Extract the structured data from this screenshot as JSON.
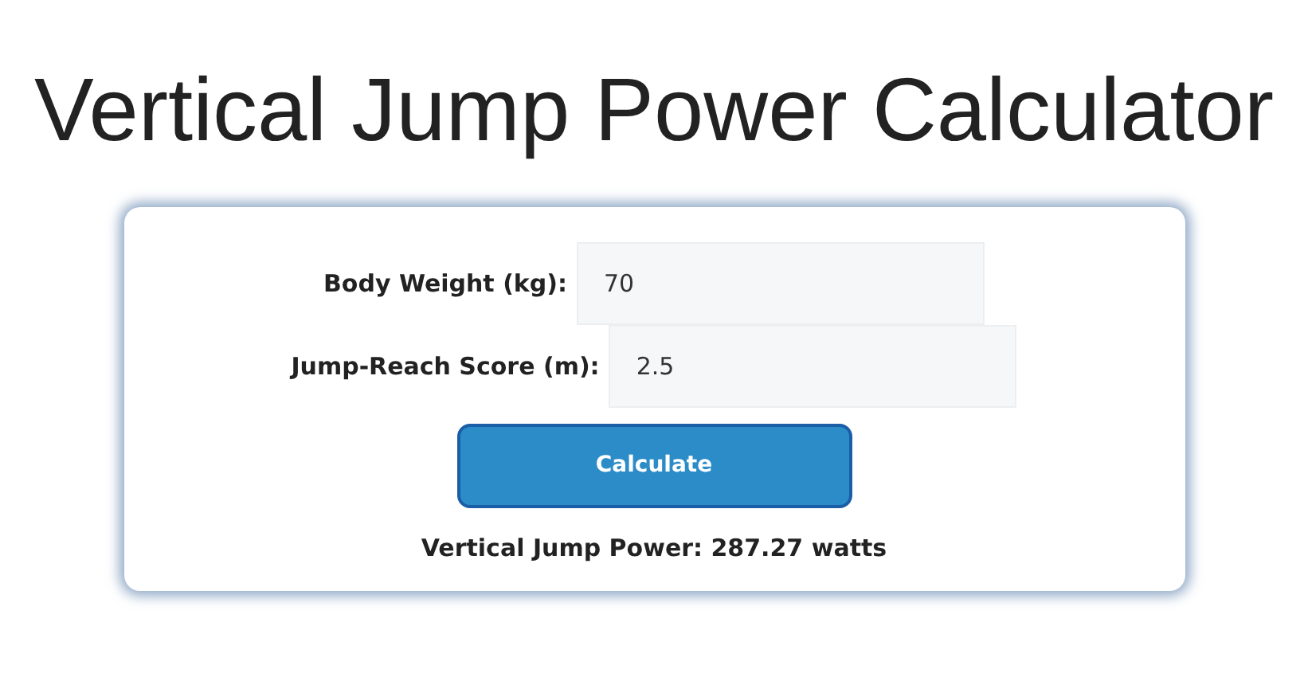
{
  "title": "Vertical Jump Power Calculator",
  "fields": [
    {
      "label": "Body Weight (kg):",
      "value": "70"
    },
    {
      "label": "Jump-Reach Score (m):",
      "value": "2.5"
    }
  ],
  "button": "Calculate",
  "result": "Vertical Jump Power: 287.27 watts"
}
